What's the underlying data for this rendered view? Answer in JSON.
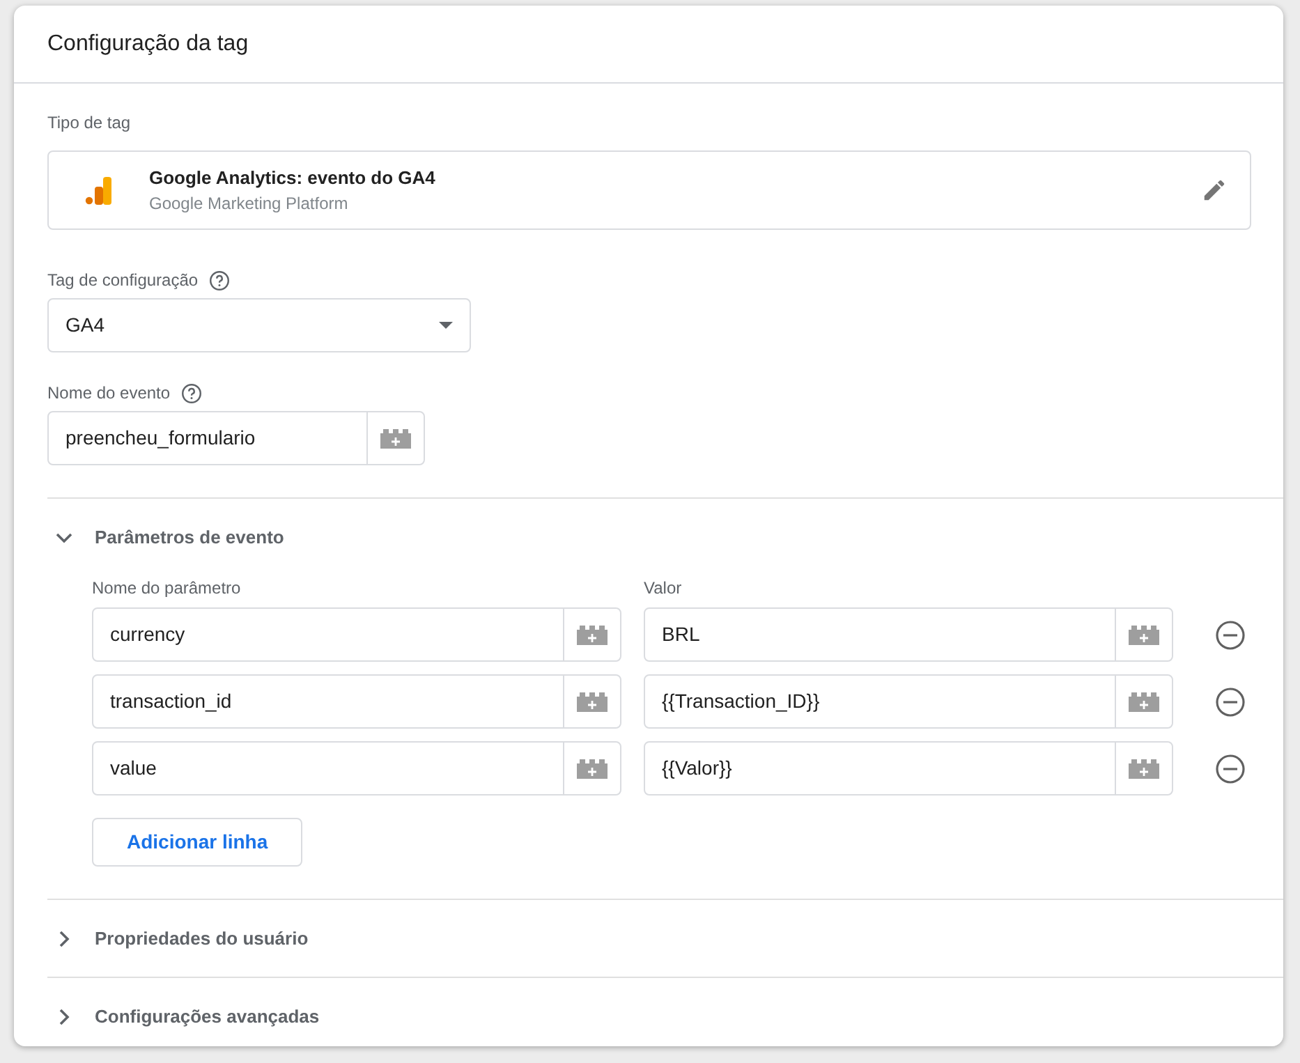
{
  "card": {
    "title": "Configuração da tag"
  },
  "tag_type": {
    "label": "Tipo de tag",
    "name": "Google Analytics: evento do GA4",
    "vendor": "Google Marketing Platform"
  },
  "config_tag": {
    "label": "Tag de configuração",
    "value": "GA4"
  },
  "event_name": {
    "label": "Nome do evento",
    "value": "preencheu_formulario"
  },
  "sections": [
    {
      "title": "Parâmetros de evento",
      "expanded": true,
      "columns": [
        "Nome do parâmetro",
        "Valor"
      ],
      "rows": [
        {
          "name": "currency",
          "value": "BRL"
        },
        {
          "name": "transaction_id",
          "value": "{{Transaction_ID}}"
        },
        {
          "name": "value",
          "value": "{{Valor}}"
        }
      ],
      "add_button": "Adicionar linha"
    },
    {
      "title": "Propriedades do usuário",
      "expanded": false
    },
    {
      "title": "Configurações avançadas",
      "expanded": false
    }
  ]
}
